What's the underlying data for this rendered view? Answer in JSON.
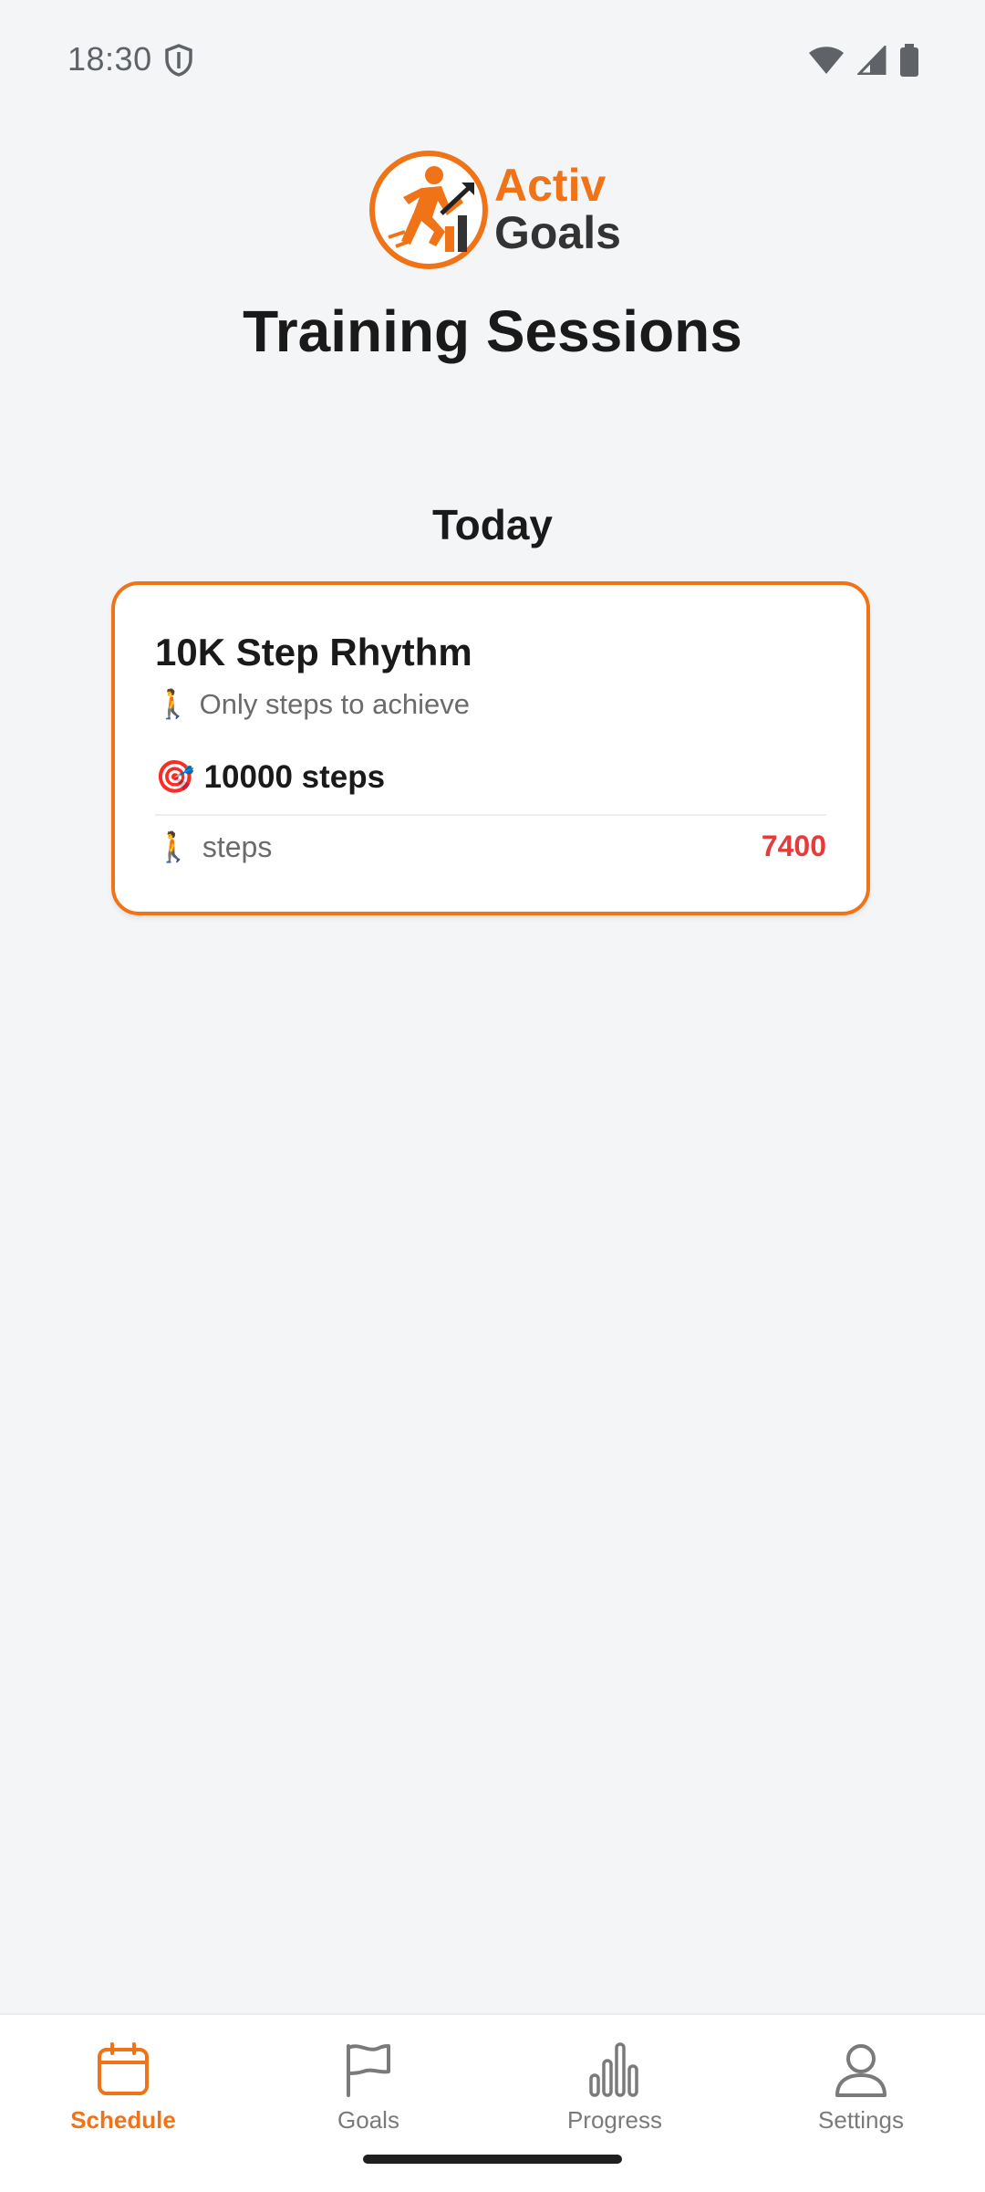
{
  "status_bar": {
    "time": "18:30"
  },
  "logo": {
    "line1": "Activ",
    "line2": "Goals"
  },
  "header": {
    "title": "Training Sessions"
  },
  "schedule": {
    "section_title": "Today",
    "card": {
      "title": "10K Step Rhythm",
      "subtitle_icon": "🚶",
      "subtitle": "Only steps to achieve",
      "goal_icon": "🎯",
      "goal": "10000 steps",
      "metric_icon": "🚶",
      "metric_label": "steps",
      "metric_value": "7400"
    }
  },
  "bottom_nav": {
    "items": [
      {
        "label": "Schedule",
        "icon": "calendar-icon",
        "active": true
      },
      {
        "label": "Goals",
        "icon": "flag-icon",
        "active": false
      },
      {
        "label": "Progress",
        "icon": "bar-chart-icon",
        "active": false
      },
      {
        "label": "Settings",
        "icon": "person-icon",
        "active": false
      }
    ]
  },
  "colors": {
    "accent": "#f07318",
    "value_red": "#e53b3b",
    "background": "#f4f5f7"
  }
}
